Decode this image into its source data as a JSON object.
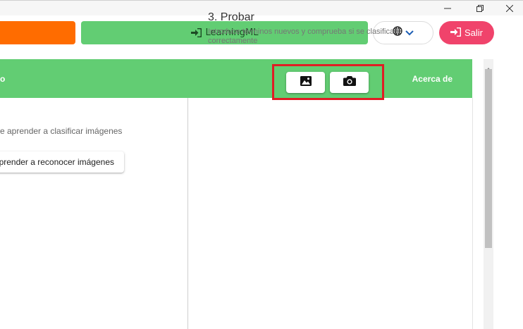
{
  "window_controls": {
    "minimize_icon": "minimize-icon",
    "restore_icon": "restore-icon",
    "close_icon": "close-icon"
  },
  "topbar": {
    "learningml_label": "LearningML",
    "language_icon": "globe-icon",
    "exit_label": "Salir"
  },
  "header": {
    "left_fragment": "o",
    "about_label": "Acerca de"
  },
  "left_panel": {
    "description_fragment": "e aprender a clasificar imágenes",
    "button_fragment": "prender a reconocer imágenes"
  },
  "test_panel": {
    "title": "3. Probar",
    "description": "Introduce términos nuevos y comprueba si se clasifican correctamente",
    "image_button_icon": "image-icon",
    "camera_button_icon": "camera-icon"
  },
  "colors": {
    "orange": "#ff6c00",
    "green": "#62cd73",
    "exit_red": "#f0436b",
    "highlight_red": "#e01c24"
  }
}
